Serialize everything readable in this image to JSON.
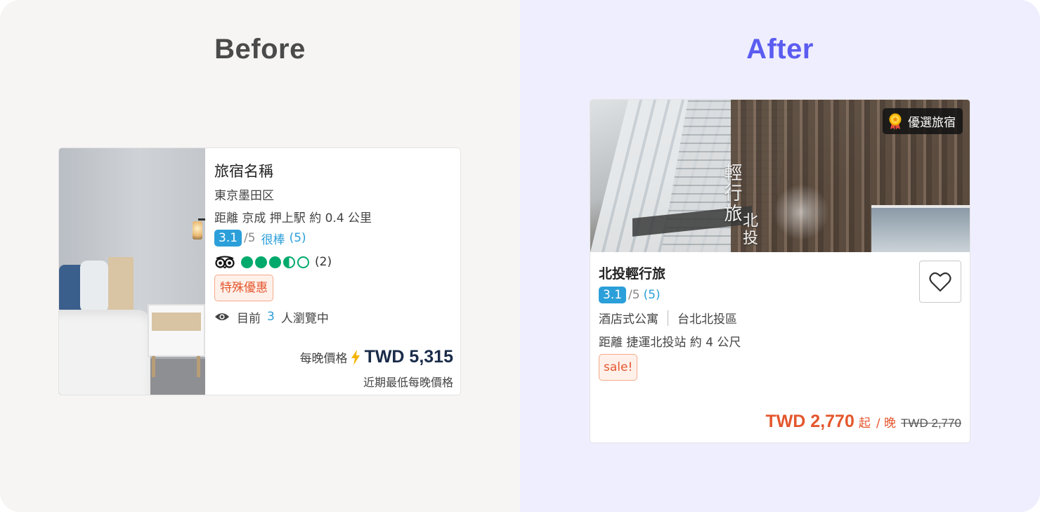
{
  "before": {
    "heading": "Before",
    "hotel_name": "旅宿名稱",
    "area": "東京墨田区",
    "distance": "距離 京成 押上駅 約 0.4 公里",
    "rating": {
      "score": "3.1",
      "max": "/5",
      "word": "很棒",
      "count": "(5)"
    },
    "tripadvisor": {
      "bubbles": [
        "full",
        "full",
        "full",
        "half",
        "empty"
      ],
      "count": "(2)"
    },
    "promo_tag": "特殊優惠",
    "viewers": {
      "prefix": "目前",
      "count": "3",
      "suffix": "人瀏覽中"
    },
    "price_label": "每晚價格",
    "price": "TWD 5,315",
    "price_note": "近期最低每晚價格"
  },
  "after": {
    "heading": "After",
    "badge": "優選旅宿",
    "photo_sign": {
      "left": "輕行旅",
      "right": "北投"
    },
    "hotel_name": "北投輕行旅",
    "rating": {
      "score": "3.1",
      "max": "/5",
      "count": "(5)"
    },
    "type": "酒店式公寓",
    "district": "台北北投區",
    "distance": "距離 捷運北投站 約 4 公尺",
    "sale_tag": "sale!",
    "price": "TWD 2,770",
    "from_label": "起",
    "per_night": "/ 晚",
    "original_price": "TWD 2,770"
  },
  "colors": {
    "before_bg": "#f6f5f3",
    "after_bg": "#efeefe",
    "after_heading": "#5b5cf0",
    "rating_blue": "#2b9fd9",
    "tripadvisor_green": "#00aa6c",
    "promo_orange": "#e4572e",
    "price_navy": "#1a2b49"
  }
}
